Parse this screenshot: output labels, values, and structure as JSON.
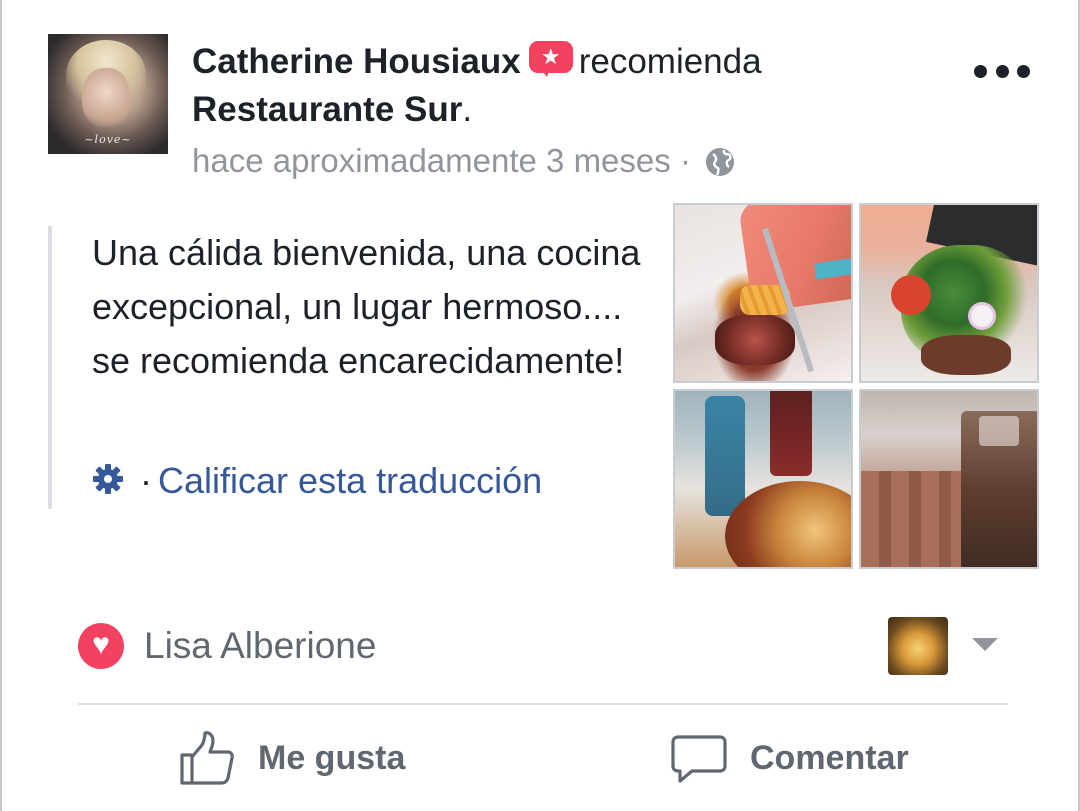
{
  "post": {
    "author_name": "Catherine Housiaux",
    "verb": "recomienda",
    "page_name": "Restaurante Sur",
    "page_suffix": ".",
    "timestamp": "hace aproximadamente 3 meses",
    "meta_separator": "·",
    "privacy_icon": "globe-icon",
    "recommend_icon": "recommend-star-icon",
    "more_icon": "more-options-icon"
  },
  "avatar": {
    "signature": "~love~"
  },
  "review": {
    "text": "Una cálida bienvenida, una cocina excepcional, un lugar hermoso.... se recomienda encarecidamente!",
    "rate_separator": "·",
    "rate_link": "Calificar esta traducción",
    "rate_icon": "gear-icon"
  },
  "photos": [
    {
      "name": "photo-steak-fries"
    },
    {
      "name": "photo-salad-plate"
    },
    {
      "name": "photo-drinks-dish"
    },
    {
      "name": "photo-iced-drink"
    }
  ],
  "reactions": {
    "icon": "love-reaction-icon",
    "reactor": "Lisa Alberione"
  },
  "actions": {
    "like_label": "Me gusta",
    "comment_label": "Comentar"
  },
  "colors": {
    "text": "#1d2129",
    "secondary": "#90949c",
    "link": "#365899",
    "accent": "#f3425f",
    "divider": "#dadde1"
  }
}
